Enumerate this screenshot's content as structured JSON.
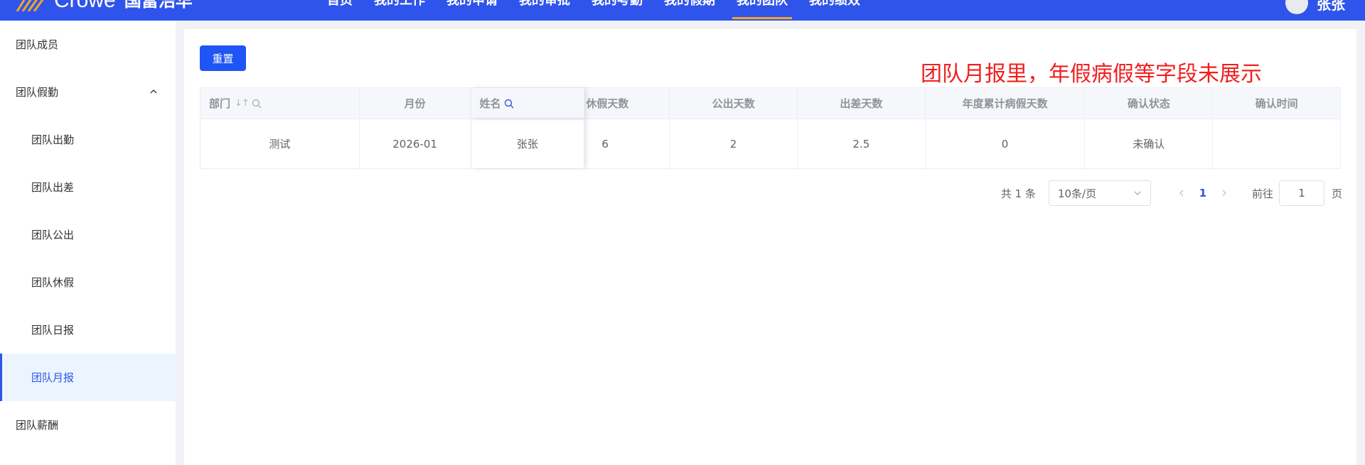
{
  "header": {
    "logo_text": "Crowe",
    "logo_subtitle": "国富浩华",
    "nav": [
      "首页",
      "我的工作",
      "我的申请",
      "我的审批",
      "我的考勤",
      "我的假期",
      "我的团队",
      "我的绩效"
    ],
    "active_nav_index": 6,
    "user_name": "张张"
  },
  "sidebar": {
    "items": [
      {
        "label": "团队成员",
        "level": "top"
      },
      {
        "label": "团队假勤",
        "level": "top",
        "expanded": true
      },
      {
        "label": "团队出勤",
        "level": "sub"
      },
      {
        "label": "团队出差",
        "level": "sub"
      },
      {
        "label": "团队公出",
        "level": "sub"
      },
      {
        "label": "团队休假",
        "level": "sub"
      },
      {
        "label": "团队日报",
        "level": "sub"
      },
      {
        "label": "团队月报",
        "level": "sub",
        "active": true
      },
      {
        "label": "团队薪酬",
        "level": "top"
      }
    ]
  },
  "main": {
    "reset_label": "重置",
    "annotation": "团队月报里，年假病假等字段未展示",
    "table": {
      "columns": [
        "部门",
        "月份",
        "姓名",
        "休假天数",
        "公出天数",
        "出差天数",
        "年度累计病假天数",
        "确认状态",
        "确认时间"
      ],
      "rows": [
        [
          "测试",
          "2026-01",
          "张张",
          "6",
          "2",
          "2.5",
          "0",
          "未确认",
          ""
        ]
      ]
    },
    "pagination": {
      "total_text": "共 1 条",
      "page_size": "10条/页",
      "current_page": "1",
      "goto_label": "前往",
      "goto_value": "1",
      "page_unit": "页"
    }
  },
  "colors": {
    "brand": "#2f54eb",
    "button": "#1f55f5",
    "annotation": "#f01f1f",
    "active_tab_underline": "#f5a623"
  }
}
